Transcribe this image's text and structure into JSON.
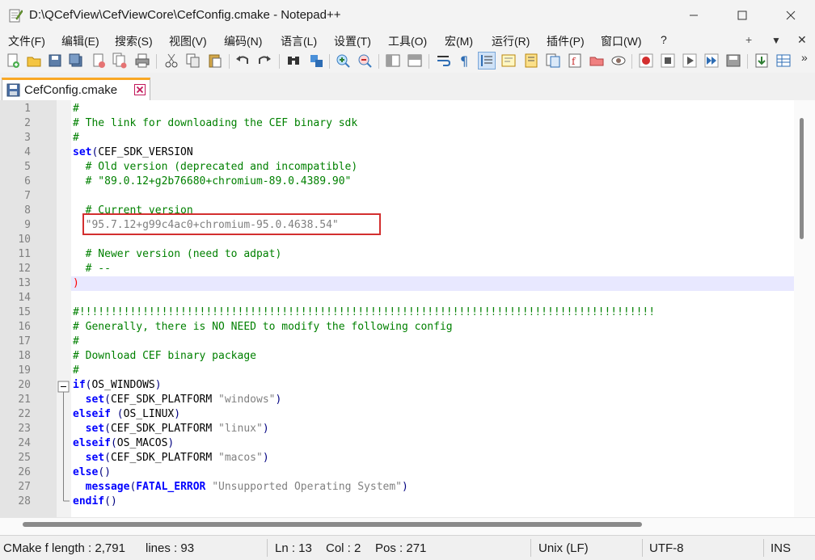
{
  "window": {
    "title": "D:\\QCefView\\CefViewCore\\CefConfig.cmake - Notepad++",
    "minimize_icon": "minimize-icon",
    "maximize_icon": "maximize-icon",
    "close_icon": "close-icon"
  },
  "menu": {
    "items": [
      "文件(F)",
      "编辑(E)",
      "搜索(S)",
      "视图(V)",
      "编码(N)",
      "语言(L)",
      "设置(T)",
      "工具(O)",
      "宏(M)",
      "运行(R)",
      "插件(P)",
      "窗口(W)",
      "?"
    ],
    "plus": "+",
    "dropdown": "▼",
    "close": "✕"
  },
  "toolbar": {
    "overflow": "»"
  },
  "tabs": [
    {
      "label": "CefConfig.cmake",
      "icon": "save-disk-icon",
      "close_icon": "tab-close-icon"
    }
  ],
  "editor": {
    "current_line": 13,
    "lines": [
      {
        "n": "1",
        "t": [
          {
            "c": "cm",
            "v": "#"
          }
        ]
      },
      {
        "n": "2",
        "t": [
          {
            "c": "cm",
            "v": "# The link for downloading the CEF binary sdk"
          }
        ]
      },
      {
        "n": "3",
        "t": [
          {
            "c": "cm",
            "v": "#"
          }
        ]
      },
      {
        "n": "4",
        "t": [
          {
            "c": "kw",
            "v": "set"
          },
          {
            "c": "op",
            "v": "("
          },
          {
            "c": "",
            "v": "CEF_SDK_VERSION"
          }
        ]
      },
      {
        "n": "5",
        "t": [
          {
            "c": "",
            "v": "  "
          },
          {
            "c": "cm",
            "v": "# Old version (deprecated and incompatible)"
          }
        ]
      },
      {
        "n": "6",
        "t": [
          {
            "c": "",
            "v": "  "
          },
          {
            "c": "cm",
            "v": "# \"89.0.12+g2b76680+chromium-89.0.4389.90\""
          }
        ]
      },
      {
        "n": "7",
        "t": []
      },
      {
        "n": "8",
        "t": [
          {
            "c": "",
            "v": "  "
          },
          {
            "c": "cm",
            "v": "# Current version"
          }
        ]
      },
      {
        "n": "9",
        "t": [
          {
            "c": "",
            "v": "  "
          },
          {
            "c": "st",
            "v": "\"95.7.12+g99c4ac0+chromium-95.0.4638.54\""
          }
        ]
      },
      {
        "n": "10",
        "t": []
      },
      {
        "n": "11",
        "t": [
          {
            "c": "",
            "v": "  "
          },
          {
            "c": "cm",
            "v": "# Newer version (need to adpat)"
          }
        ]
      },
      {
        "n": "12",
        "t": [
          {
            "c": "",
            "v": "  "
          },
          {
            "c": "cm",
            "v": "# --"
          }
        ]
      },
      {
        "n": "13",
        "t": [
          {
            "c": "rp",
            "v": ")"
          }
        ]
      },
      {
        "n": "14",
        "t": []
      },
      {
        "n": "15",
        "t": [
          {
            "c": "cm",
            "v": "#!!!!!!!!!!!!!!!!!!!!!!!!!!!!!!!!!!!!!!!!!!!!!!!!!!!!!!!!!!!!!!!!!!!!!!!!!!!!!!!!!!!!!!!!!!!"
          }
        ]
      },
      {
        "n": "16",
        "t": [
          {
            "c": "cm",
            "v": "# Generally, there is NO NEED to modify the following config"
          }
        ]
      },
      {
        "n": "17",
        "t": [
          {
            "c": "cm",
            "v": "#"
          }
        ]
      },
      {
        "n": "18",
        "t": [
          {
            "c": "cm",
            "v": "# Download CEF binary package"
          }
        ]
      },
      {
        "n": "19",
        "t": [
          {
            "c": "cm",
            "v": "#"
          }
        ]
      },
      {
        "n": "20",
        "t": [
          {
            "c": "kw",
            "v": "if"
          },
          {
            "c": "op",
            "v": "("
          },
          {
            "c": "",
            "v": "OS_WINDOWS"
          },
          {
            "c": "op",
            "v": ")"
          }
        ]
      },
      {
        "n": "21",
        "t": [
          {
            "c": "",
            "v": "  "
          },
          {
            "c": "kw",
            "v": "set"
          },
          {
            "c": "op",
            "v": "("
          },
          {
            "c": "",
            "v": "CEF_SDK_PLATFORM "
          },
          {
            "c": "st",
            "v": "\"windows\""
          },
          {
            "c": "op",
            "v": ")"
          }
        ]
      },
      {
        "n": "22",
        "t": [
          {
            "c": "kw",
            "v": "elseif"
          },
          {
            "c": "",
            "v": " "
          },
          {
            "c": "op",
            "v": "("
          },
          {
            "c": "",
            "v": "OS_LINUX"
          },
          {
            "c": "op",
            "v": ")"
          }
        ]
      },
      {
        "n": "23",
        "t": [
          {
            "c": "",
            "v": "  "
          },
          {
            "c": "kw",
            "v": "set"
          },
          {
            "c": "op",
            "v": "("
          },
          {
            "c": "",
            "v": "CEF_SDK_PLATFORM "
          },
          {
            "c": "st",
            "v": "\"linux\""
          },
          {
            "c": "op",
            "v": ")"
          }
        ]
      },
      {
        "n": "24",
        "t": [
          {
            "c": "kw",
            "v": "elseif"
          },
          {
            "c": "op",
            "v": "("
          },
          {
            "c": "",
            "v": "OS_MACOS"
          },
          {
            "c": "op",
            "v": ")"
          }
        ]
      },
      {
        "n": "25",
        "t": [
          {
            "c": "",
            "v": "  "
          },
          {
            "c": "kw",
            "v": "set"
          },
          {
            "c": "op",
            "v": "("
          },
          {
            "c": "",
            "v": "CEF_SDK_PLATFORM "
          },
          {
            "c": "st",
            "v": "\"macos\""
          },
          {
            "c": "op",
            "v": ")"
          }
        ]
      },
      {
        "n": "26",
        "t": [
          {
            "c": "kw",
            "v": "else"
          },
          {
            "c": "op",
            "v": "()"
          }
        ]
      },
      {
        "n": "27",
        "t": [
          {
            "c": "",
            "v": "  "
          },
          {
            "c": "kw",
            "v": "message"
          },
          {
            "c": "op",
            "v": "("
          },
          {
            "c": "kw",
            "v": "FATAL_ERROR"
          },
          {
            "c": "",
            "v": " "
          },
          {
            "c": "st",
            "v": "\"Unsupported Operating System\""
          },
          {
            "c": "op",
            "v": ")"
          }
        ]
      },
      {
        "n": "28",
        "t": [
          {
            "c": "kw",
            "v": "endif"
          },
          {
            "c": "op",
            "v": "()"
          }
        ]
      }
    ]
  },
  "status": {
    "language": "CMake f",
    "length": "length : 2,791",
    "lines": "lines : 93",
    "ln": "Ln : 13",
    "col": "Col : 2",
    "pos": "Pos : 271",
    "eol": "Unix (LF)",
    "encoding": "UTF-8",
    "mode": "INS"
  },
  "colors": {
    "keyword": "#0000ff",
    "comment": "#008000",
    "string": "#808080",
    "current_line": "#e8e8ff",
    "highlight_box": "#d32f2f",
    "tab_accent": "#f9a825"
  }
}
